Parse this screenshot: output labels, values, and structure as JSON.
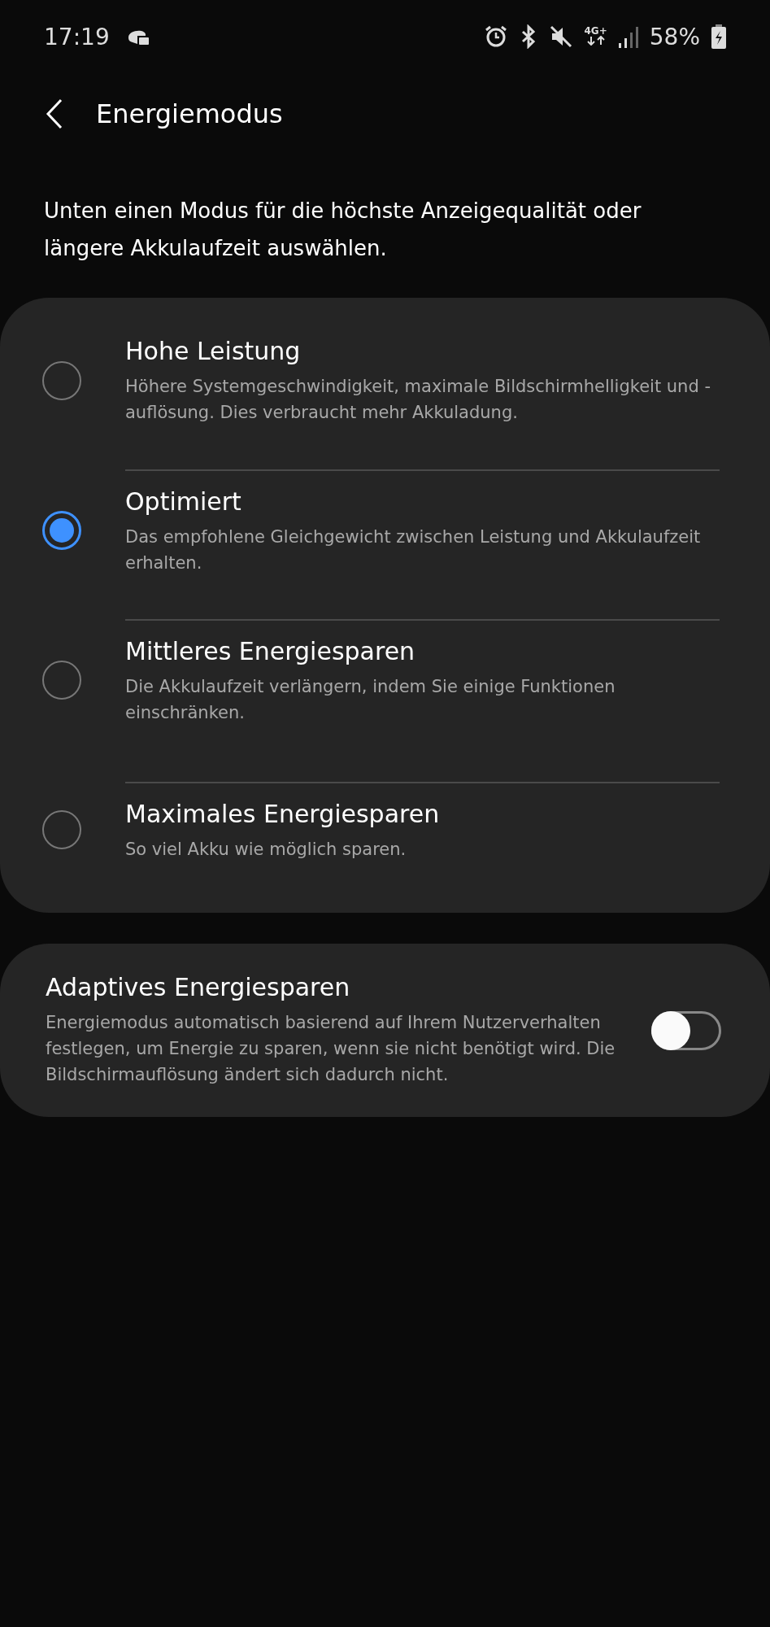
{
  "status_bar": {
    "time": "17:19",
    "network": "4G+",
    "battery": "58%"
  },
  "header": {
    "title": "Energiemodus"
  },
  "description": "Unten einen Modus für die höchste Anzeigequalität oder längere Akkulaufzeit auswählen.",
  "modes": [
    {
      "title": "Hohe Leistung",
      "subtitle": "Höhere Systemgeschwindigkeit, maximale Bildschirmhelligkeit und -auflösung. Dies verbraucht mehr Akkuladung.",
      "selected": false
    },
    {
      "title": "Optimiert",
      "subtitle": "Das empfohlene Gleichgewicht zwischen Leistung und Akkulaufzeit erhalten.",
      "selected": true
    },
    {
      "title": "Mittleres Energiesparen",
      "subtitle": "Die Akkulaufzeit verlängern, indem Sie einige Funktionen einschränken.",
      "selected": false
    },
    {
      "title": "Maximales Energiesparen",
      "subtitle": "So viel Akku wie möglich sparen.",
      "selected": false
    }
  ],
  "adaptive": {
    "title": "Adaptives Energiesparen",
    "subtitle": "Energiemodus automatisch basierend auf Ihrem Nutzerverhalten festlegen, um Energie zu sparen, wenn sie nicht benötigt wird. Die Bildschirmauflösung ändert sich dadurch nicht.",
    "on": false
  }
}
